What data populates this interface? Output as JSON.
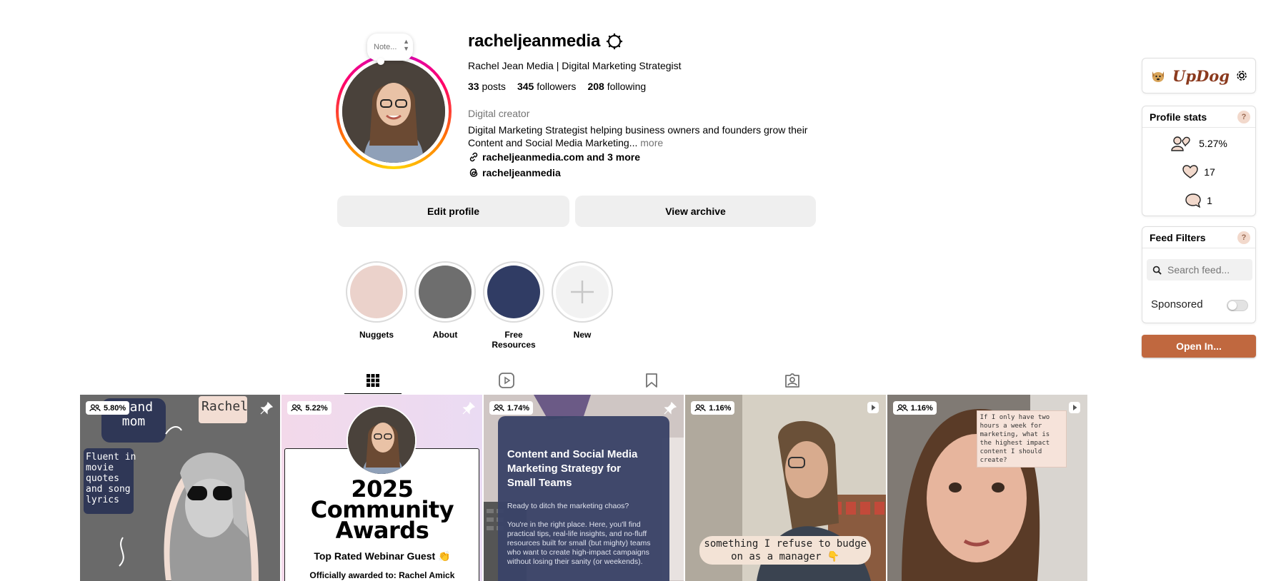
{
  "profile": {
    "note_label": "Note...",
    "username": "racheljeanmedia",
    "full_name": "Rachel Jean Media | Digital Marketing Strategist",
    "posts_count": "33",
    "posts_label": "posts",
    "followers_count": "345",
    "followers_label": "followers",
    "following_count": "208",
    "following_label": "following",
    "category": "Digital creator",
    "bio_line1": "Digital Marketing Strategist helping business owners and founders grow their",
    "bio_line2": "Content and Social Media Marketing...",
    "bio_more": "more",
    "link_text": "racheljeanmedia.com and 3 more",
    "threads_handle": "racheljeanmedia"
  },
  "actions": {
    "edit_profile": "Edit profile",
    "view_archive": "View archive"
  },
  "highlights": [
    {
      "label": "Nuggets",
      "color": "#ebd2cb"
    },
    {
      "label": "About",
      "color": "#6e6e6e"
    },
    {
      "label": "Free Resources",
      "color": "#303c64"
    },
    {
      "label": "New",
      "color": "#f2f2f2"
    }
  ],
  "tabs": [
    "posts-grid-icon",
    "reels-icon",
    "saved-icon",
    "tagged-icon"
  ],
  "posts": [
    {
      "engagement": "5.80%",
      "overlay": {
        "name_tag": "Rachel",
        "bubble": "e and\nmom",
        "side": "Fluent in\nmovie\nquotes\nand song\nlyrics"
      },
      "corner": "pin-icon"
    },
    {
      "engagement": "5.22%",
      "overlay": {
        "heading1": "2025",
        "heading2": "Community",
        "heading3": "Awards",
        "sub": "Top Rated Webinar Guest 👏",
        "footer": "Officially awarded to: Rachel Amick"
      },
      "corner": "pin-icon"
    },
    {
      "engagement": "1.74%",
      "overlay": {
        "title": "Content and Social Media Marketing Strategy for Small Teams",
        "p1": "Ready to ditch the marketing chaos?",
        "p2": "You're in the right place. Here, you'll find practical tips, real-life insights, and no-fluff resources built for small (but mighty) teams who want to create high-impact campaigns without losing their sanity (or weekends)."
      },
      "corner": "pin-icon"
    },
    {
      "engagement": "1.16%",
      "overlay": {
        "caption": "something I refuse to budge\non as a manager 👇"
      },
      "corner": "reel-icon"
    },
    {
      "engagement": "1.16%",
      "overlay": {
        "note": "If I only have two hours a week for marketing, what is the highest impact content I should create?"
      },
      "corner": "reel-icon"
    }
  ],
  "extension": {
    "brand": "UpDog",
    "profile_stats_title": "Profile stats",
    "help": "?",
    "engagement_rate": "5.27%",
    "avg_likes": "17",
    "avg_comments": "1",
    "feed_filters_title": "Feed Filters",
    "search_placeholder": "Search feed...",
    "sponsored_label": "Sponsored",
    "sponsored_enabled": false,
    "open_in_label": "Open In..."
  },
  "colors": {
    "accent": "#c0683f",
    "button_bg": "#efefef",
    "muted_text": "#737373"
  }
}
